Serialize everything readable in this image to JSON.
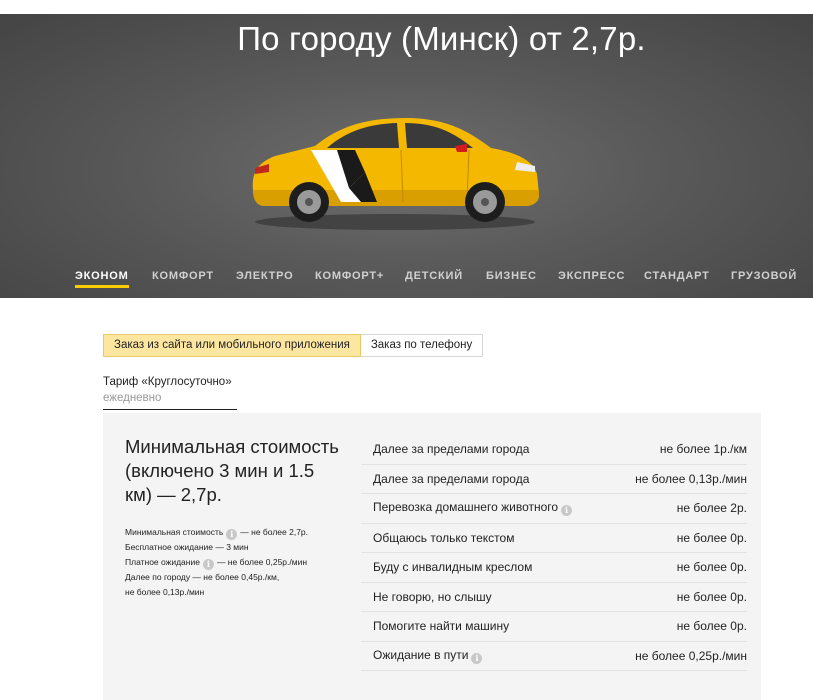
{
  "hero": {
    "title": "По городу (Минск) от 2,7р."
  },
  "tabs": [
    {
      "label": "Эконом",
      "active": true
    },
    {
      "label": "Комфорт",
      "active": false
    },
    {
      "label": "Электро",
      "active": false
    },
    {
      "label": "Комфорт+",
      "active": false
    },
    {
      "label": "Детский",
      "active": false
    },
    {
      "label": "Бизнес",
      "active": false
    },
    {
      "label": "Экспресс",
      "active": false
    },
    {
      "label": "Стандарт",
      "active": false
    },
    {
      "label": "Грузовой",
      "active": false
    }
  ],
  "order_type": {
    "options": [
      "Заказ из сайта или мобильного приложения",
      "Заказ по телефону"
    ],
    "selected": "Заказ из сайта или мобильного приложения"
  },
  "tariff": {
    "name": "Тариф «Круглосуточно»",
    "schedule": "ежедневно"
  },
  "summary": {
    "title": "Минимальная стоимость (включено 3 мин и 1.5 км) — 2,7р.",
    "details": [
      {
        "label": "Минимальная стоимость",
        "info": true,
        "value": "— не более 2,7р."
      },
      {
        "label": "Бесплатное ожидание — 3 мин",
        "info": false,
        "value": ""
      },
      {
        "label": "Платное ожидание",
        "info": true,
        "value": "— не более 0,25р./мин"
      },
      {
        "label": "Далее по городу — не более 0,45р./км,",
        "info": false,
        "value": ""
      },
      {
        "label": "не более 0,13р./мин",
        "info": false,
        "value": ""
      }
    ]
  },
  "price_rows": [
    {
      "label": "Далее за пределами города",
      "info": false,
      "value": "не более 1р./км"
    },
    {
      "label": "Далее за пределами города",
      "info": false,
      "value": "не более 0,13р./мин"
    },
    {
      "label": "Перевозка домашнего животного",
      "info": true,
      "value": "не более 2р."
    },
    {
      "label": "Общаюсь только текстом",
      "info": false,
      "value": "не более 0р."
    },
    {
      "label": "Буду с инвалидным креслом",
      "info": false,
      "value": "не более 0р."
    },
    {
      "label": "Не говорю, но слышу",
      "info": false,
      "value": "не более 0р."
    },
    {
      "label": "Помогите найти машину",
      "info": false,
      "value": "не более 0р."
    },
    {
      "label": "Ожидание в пути",
      "info": true,
      "value": "не более 0,25р./мин"
    }
  ],
  "colors": {
    "accent": "#ffcc00",
    "selected_toggle": "#fde6a0",
    "card_bg": "#f4f4f4",
    "car_body": "#f5b800"
  }
}
